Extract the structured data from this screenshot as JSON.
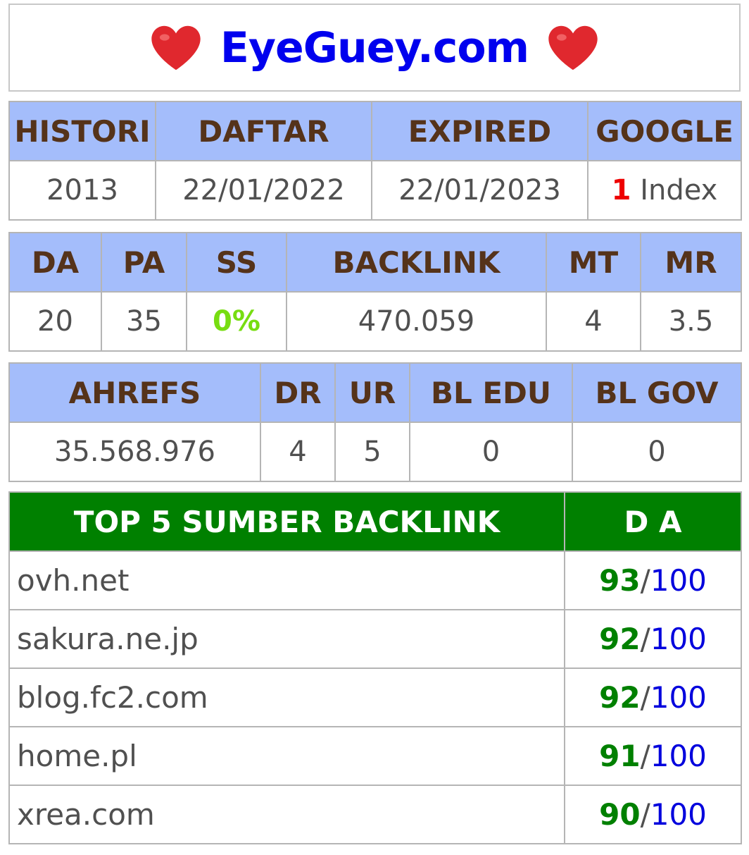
{
  "header": {
    "title": "EyeGuey.com",
    "left_icon": "heart-icon",
    "right_icon": "heart-icon"
  },
  "table1": {
    "headers": [
      "HISTORI",
      "DAFTAR",
      "EXPIRED",
      "GOOGLE"
    ],
    "values": {
      "histori": "2013",
      "daftar": "22/01/2022",
      "expired": "22/01/2023",
      "google_count": "1",
      "google_label": "Index"
    }
  },
  "table2": {
    "headers": [
      "DA",
      "PA",
      "SS",
      "BACKLINK",
      "MT",
      "MR"
    ],
    "values": [
      "20",
      "35",
      "0%",
      "470.059",
      "4",
      "3.5"
    ]
  },
  "table3": {
    "headers": [
      "AHREFS",
      "DR",
      "UR",
      "BL EDU",
      "BL GOV"
    ],
    "values": [
      "35.568.976",
      "4",
      "5",
      "0",
      "0"
    ]
  },
  "top5": {
    "headers": [
      "TOP 5 SUMBER BACKLINK",
      "D A"
    ],
    "rows": [
      {
        "site": "ovh.net",
        "da": "93",
        "max": "100"
      },
      {
        "site": "sakura.ne.jp",
        "da": "92",
        "max": "100"
      },
      {
        "site": "blog.fc2.com",
        "da": "92",
        "max": "100"
      },
      {
        "site": "home.pl",
        "da": "91",
        "max": "100"
      },
      {
        "site": "xrea.com",
        "da": "90",
        "max": "100"
      }
    ]
  },
  "colors": {
    "header_bg": "#a4bdfb",
    "header_text": "#55331a",
    "green": "#008000",
    "blue": "#0000ee",
    "red": "#ee0000",
    "lime": "#77dd11"
  }
}
